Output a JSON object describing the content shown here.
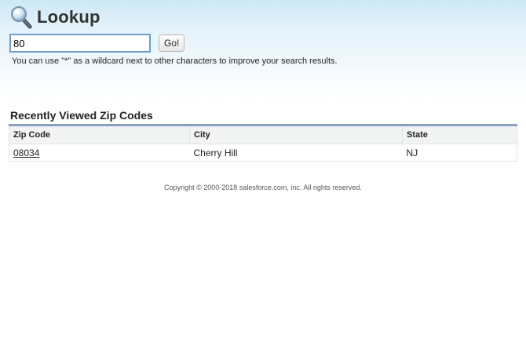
{
  "header": {
    "title": "Lookup",
    "icon": "magnifier-icon"
  },
  "search": {
    "value": "80",
    "button_label": "Go!",
    "hint": "You can use \"*\" as a wildcard next to other characters to improve your search results."
  },
  "recent": {
    "title": "Recently Viewed Zip Codes",
    "columns": [
      "Zip Code",
      "City",
      "State"
    ],
    "rows": [
      {
        "zip": "08034",
        "city": "Cherry Hill",
        "state": "NJ"
      }
    ]
  },
  "footer": {
    "copyright": "Copyright © 2000-2018 salesforce.com, inc. All rights reserved."
  },
  "colors": {
    "table_accent": "#8a9ebe",
    "header_gradient_top": "#cfe9f6"
  }
}
